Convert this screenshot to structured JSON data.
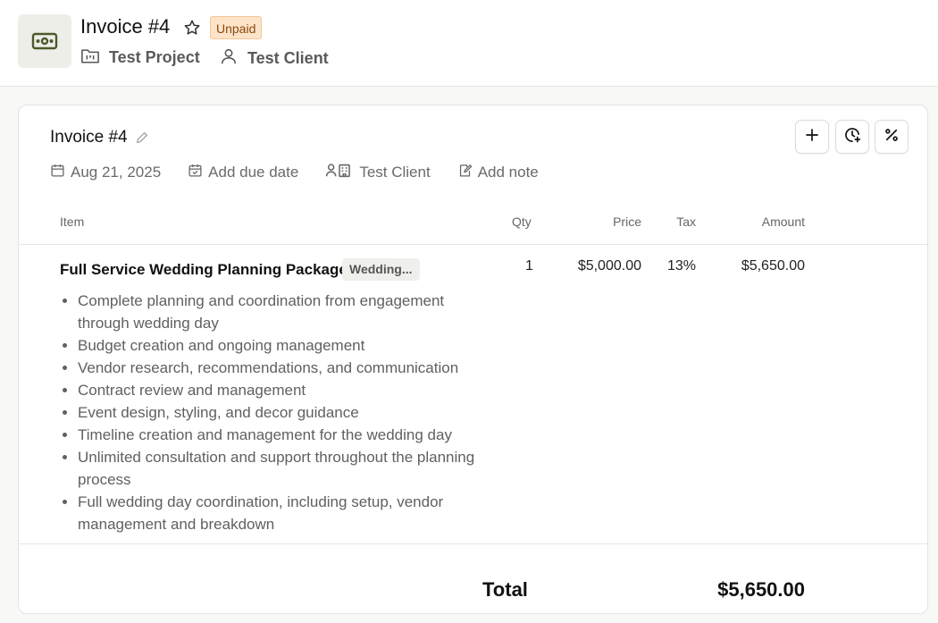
{
  "header": {
    "title": "Invoice #4",
    "status_badge": "Unpaid",
    "project_link": "Test Project",
    "client_link": "Test Client",
    "icons": {
      "app": "money-bill-icon",
      "favorite": "star-icon",
      "project": "folder-icon",
      "client": "user-icon"
    }
  },
  "invoice": {
    "title": "Invoice #4",
    "date": "Aug 21, 2025",
    "due_date_placeholder": "Add due date",
    "client": "Test Client",
    "note_placeholder": "Add note",
    "tools": [
      "plus-icon",
      "clock-plus-icon",
      "percent-icon"
    ]
  },
  "table": {
    "columns": {
      "item": "Item",
      "qty": "Qty",
      "price": "Price",
      "tax": "Tax",
      "amount": "Amount"
    },
    "rows": [
      {
        "name": "Full Service Wedding Planning Package",
        "tag": "Wedding...",
        "qty": "1",
        "price": "$5,000.00",
        "tax": "13%",
        "amount": "$5,650.00",
        "description": [
          "Complete planning and coordination from engagement through wedding day",
          "Budget creation and ongoing management",
          "Vendor research, recommendations, and communication",
          "Contract review and management",
          "Event design, styling, and decor guidance",
          "Timeline creation and management for the wedding day",
          "Unlimited consultation and support throughout the planning process",
          "Full wedding day coordination, including setup, vendor management and breakdown"
        ]
      }
    ]
  },
  "totals": {
    "label": "Total",
    "value": "$5,650.00"
  },
  "colors": {
    "badge_bg": "#fde3c7",
    "badge_text": "#8a4a12",
    "app_icon": "#4a5a2a"
  }
}
